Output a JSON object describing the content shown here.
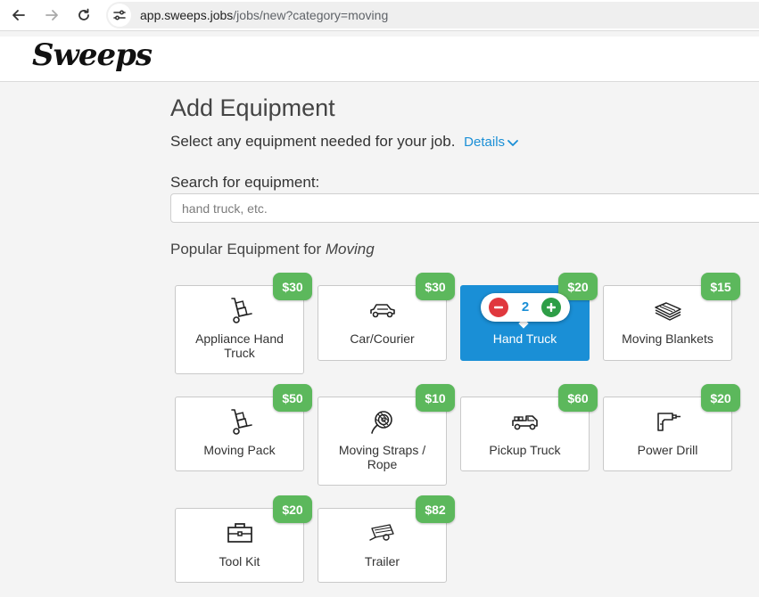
{
  "browser": {
    "url_host": "app.sweeps.jobs",
    "url_path": "/jobs/new?category=moving"
  },
  "site": {
    "logo": "Sweeps"
  },
  "page": {
    "title": "Add Equipment",
    "subtitle": "Select any equipment needed for your job.",
    "details_link": "Details",
    "search_label": "Search for equipment:",
    "search_placeholder": "hand truck, etc.",
    "search_value": "",
    "popular_prefix": "Popular Equipment for ",
    "popular_category": "Moving"
  },
  "colors": {
    "selected_card": "#1a8fd6",
    "price_badge": "#5cb85c",
    "minus_button": "#e0383e",
    "plus_button": "#2e9e47"
  },
  "equipment": [
    {
      "name": "Appliance Hand Truck",
      "line1": "Appliance Hand",
      "line2": "Truck",
      "price": "$30",
      "icon": "hand-truck-icon"
    },
    {
      "name": "Car/Courier",
      "line1": "Car/Courier",
      "line2": "",
      "price": "$30",
      "icon": "car-icon"
    },
    {
      "name": "Hand Truck",
      "line1": "Hand Truck",
      "line2": "",
      "price": "$20",
      "icon": "hand-truck-icon",
      "selected": true,
      "quantity": "2"
    },
    {
      "name": "Moving Blankets",
      "line1": "Moving Blankets",
      "line2": "",
      "price": "$15",
      "icon": "blankets-icon"
    },
    {
      "name": "Moving Pack",
      "line1": "Moving Pack",
      "line2": "",
      "price": "$50",
      "icon": "hand-truck-icon"
    },
    {
      "name": "Moving Straps / Rope",
      "line1": "Moving Straps /",
      "line2": "Rope",
      "price": "$10",
      "icon": "rope-icon"
    },
    {
      "name": "Pickup Truck",
      "line1": "Pickup Truck",
      "line2": "",
      "price": "$60",
      "icon": "pickup-truck-icon"
    },
    {
      "name": "Power Drill",
      "line1": "Power Drill",
      "line2": "",
      "price": "$20",
      "icon": "power-drill-icon"
    },
    {
      "name": "Tool Kit",
      "line1": "Tool Kit",
      "line2": "",
      "price": "$20",
      "icon": "toolbox-icon"
    },
    {
      "name": "Trailer",
      "line1": "Trailer",
      "line2": "",
      "price": "$82",
      "icon": "trailer-icon"
    }
  ]
}
